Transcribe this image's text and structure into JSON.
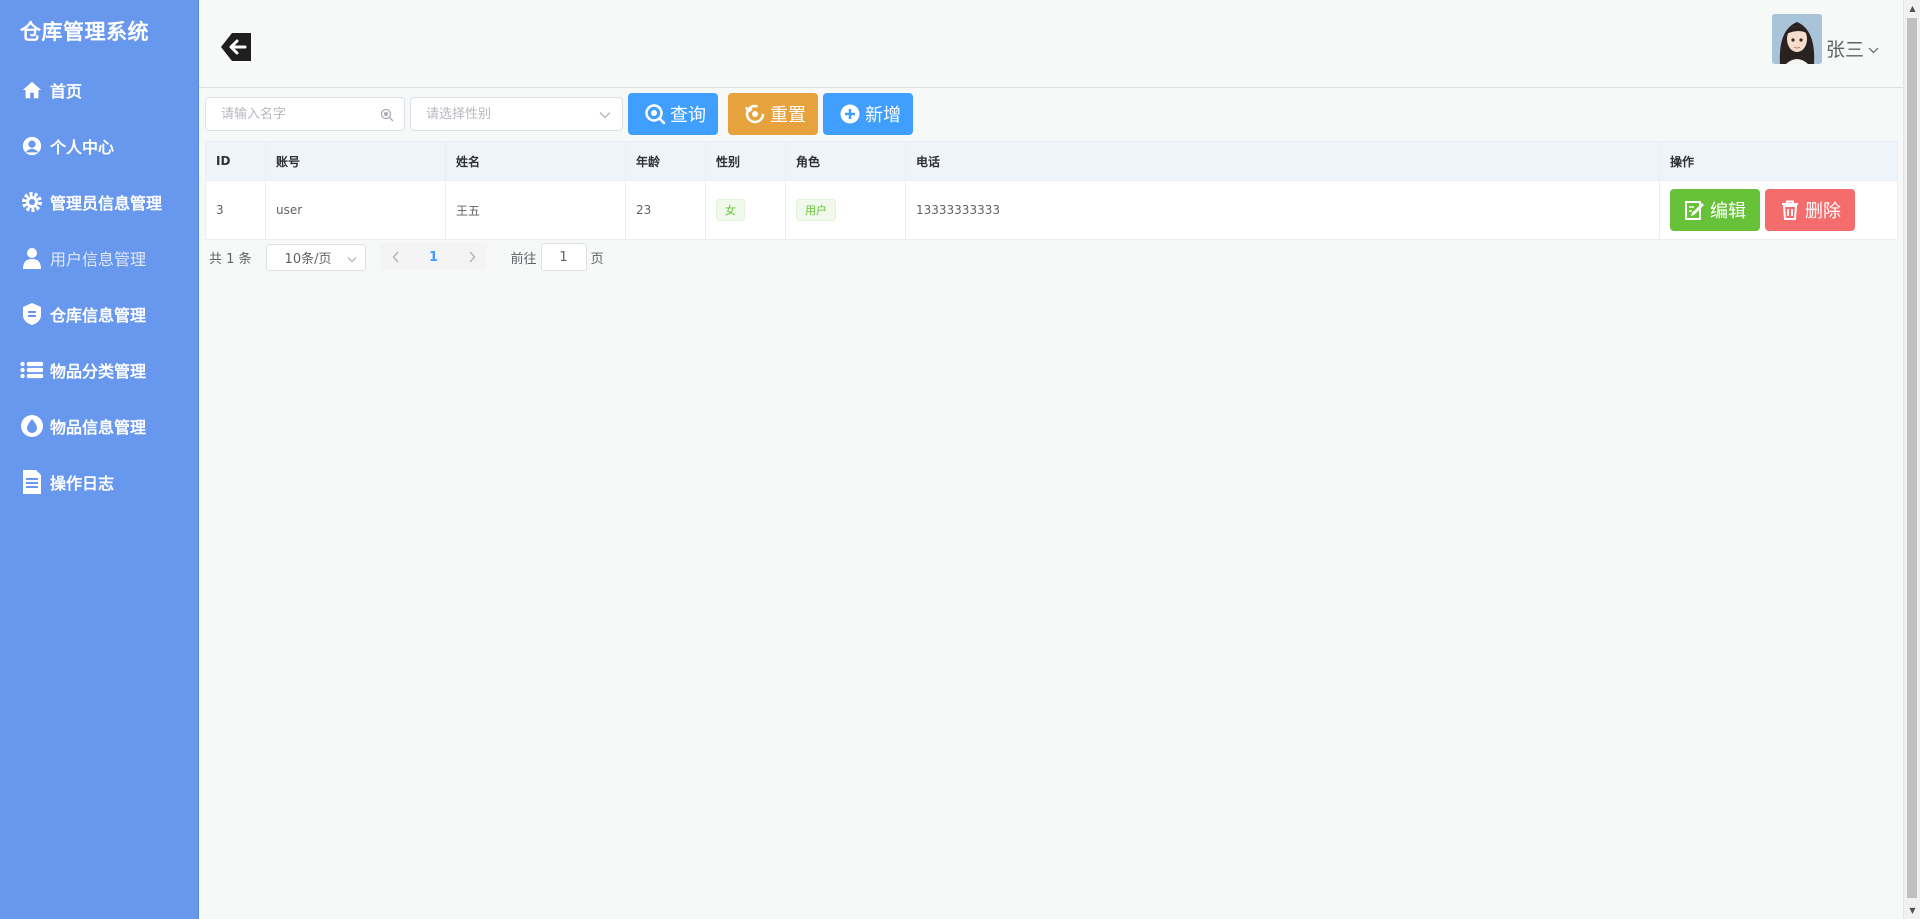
{
  "app": {
    "title": "仓库管理系统"
  },
  "sidebar": {
    "items": [
      {
        "label": "首页",
        "icon": "home-icon"
      },
      {
        "label": "个人中心",
        "icon": "user-center-icon"
      },
      {
        "label": "管理员信息管理",
        "icon": "gear-icon"
      },
      {
        "label": "用户信息管理",
        "icon": "user-icon",
        "active": true
      },
      {
        "label": "仓库信息管理",
        "icon": "warehouse-icon"
      },
      {
        "label": "物品分类管理",
        "icon": "list-icon"
      },
      {
        "label": "物品信息管理",
        "icon": "drop-icon"
      },
      {
        "label": "操作日志",
        "icon": "document-icon"
      }
    ]
  },
  "header": {
    "username": "张三"
  },
  "toolbar": {
    "name_placeholder": "请输入名字",
    "gender_placeholder": "请选择性别",
    "search_label": "查询",
    "reset_label": "重置",
    "add_label": "新增"
  },
  "table": {
    "columns": [
      "ID",
      "账号",
      "姓名",
      "年龄",
      "性别",
      "角色",
      "电话",
      "操作"
    ],
    "rows": [
      {
        "id": "3",
        "account": "user",
        "name": "王五",
        "age": "23",
        "gender": "女",
        "role": "用户",
        "phone": "13333333333"
      }
    ],
    "edit_label": "编辑",
    "delete_label": "删除"
  },
  "pagination": {
    "total_text": "共 1 条",
    "page_size": "10条/页",
    "current_page": "1",
    "goto_prefix": "前往",
    "goto_value": "1",
    "goto_suffix": "页"
  },
  "colors": {
    "sidebar_bg": "#6897ee",
    "primary": "#409eff",
    "warning": "#e6a23c",
    "success": "#67c23a",
    "danger": "#f56c6c"
  }
}
